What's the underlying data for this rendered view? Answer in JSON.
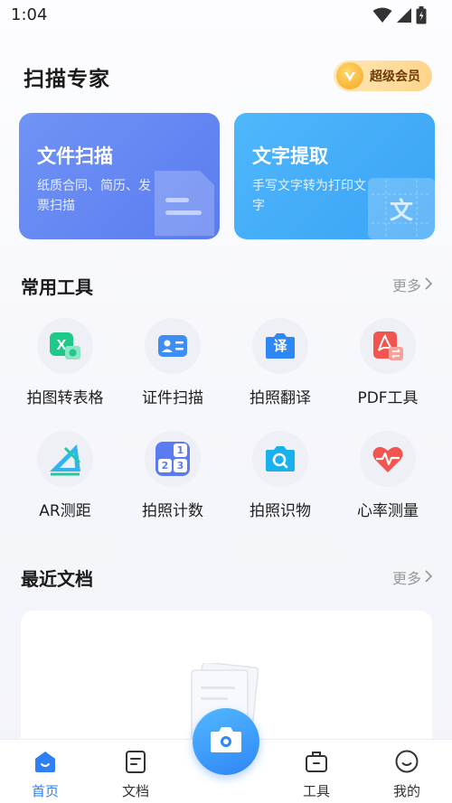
{
  "status": {
    "time": "1:04"
  },
  "header": {
    "title": "扫描专家",
    "vip_label": "超级会员"
  },
  "cards": [
    {
      "title": "文件扫描",
      "subtitle": "纸质合同、简历、发票扫描"
    },
    {
      "title": "文字提取",
      "subtitle": "手写文字转为打印文字",
      "icon_text": "文"
    }
  ],
  "tools_section": {
    "title": "常用工具",
    "more": "更多"
  },
  "tools": [
    {
      "label": "拍图转表格",
      "icon": "table-icon"
    },
    {
      "label": "证件扫描",
      "icon": "id-card-icon"
    },
    {
      "label": "拍照翻译",
      "icon": "translate-icon",
      "icon_text": "译"
    },
    {
      "label": "PDF工具",
      "icon": "pdf-icon"
    },
    {
      "label": "AR测距",
      "icon": "ruler-icon"
    },
    {
      "label": "拍照计数",
      "icon": "count-icon",
      "icon_digits": [
        "1",
        "2",
        "3"
      ]
    },
    {
      "label": "拍照识物",
      "icon": "object-search-icon"
    },
    {
      "label": "心率测量",
      "icon": "heart-rate-icon"
    }
  ],
  "recent_section": {
    "title": "最近文档",
    "more": "更多"
  },
  "nav": {
    "home": "首页",
    "docs": "文档",
    "tools": "工具",
    "mine": "我的"
  },
  "colors": {
    "accent": "#2f7ff5",
    "scan_card": "#5b7cf0",
    "ocr_card": "#3aa3f6"
  }
}
